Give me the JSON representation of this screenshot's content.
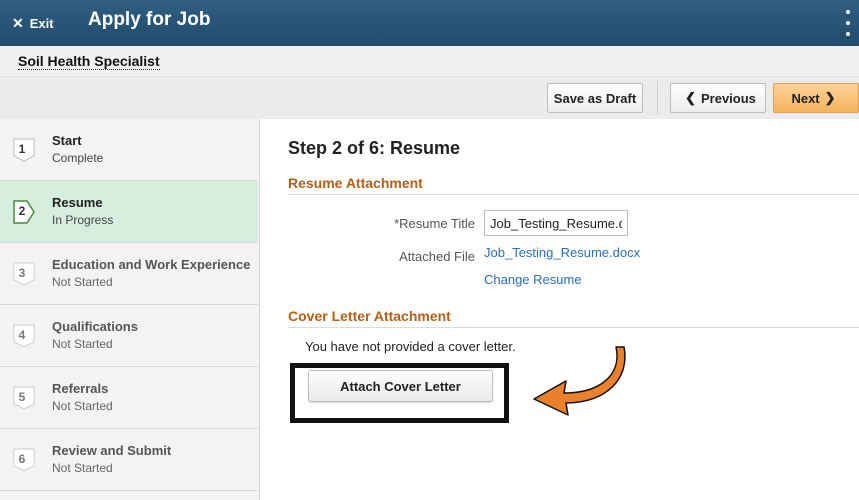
{
  "header": {
    "exit_label": "Exit",
    "title": "Apply for Job"
  },
  "job": {
    "title": "Soil Health Specialist"
  },
  "toolbar": {
    "save_draft_label": "Save as Draft",
    "previous_label": "Previous",
    "next_label": "Next"
  },
  "steps": [
    {
      "number": "1",
      "name": "Start",
      "status": "Complete"
    },
    {
      "number": "2",
      "name": "Resume",
      "status": "In Progress"
    },
    {
      "number": "3",
      "name": "Education and Work Experience",
      "status": "Not Started"
    },
    {
      "number": "4",
      "name": "Qualifications",
      "status": "Not Started"
    },
    {
      "number": "5",
      "name": "Referrals",
      "status": "Not Started"
    },
    {
      "number": "6",
      "name": "Review and Submit",
      "status": "Not Started"
    }
  ],
  "main": {
    "step_heading": "Step 2 of 6: Resume",
    "resume_section": {
      "heading": "Resume Attachment",
      "title_label": "*Resume Title",
      "title_value": "Job_Testing_Resume.doc",
      "file_label": "Attached File",
      "file_name": "Job_Testing_Resume.docx",
      "change_label": "Change Resume"
    },
    "cover_section": {
      "heading": "Cover Letter Attachment",
      "message": "You have not provided a cover letter.",
      "attach_label": "Attach Cover Letter"
    }
  },
  "colors": {
    "header_bg": "#2a587a",
    "active_step_bg": "#d6eede",
    "section_heading": "#b45f14",
    "link": "#2a6fb6",
    "next_button": "#f5b25c",
    "callout_arrow": "#e8812a"
  },
  "icons": {
    "exit": "close-icon",
    "menu": "kebab-menu-icon",
    "previous": "chevron-left-icon",
    "next": "chevron-right-icon",
    "callout": "curved-arrow-icon"
  }
}
